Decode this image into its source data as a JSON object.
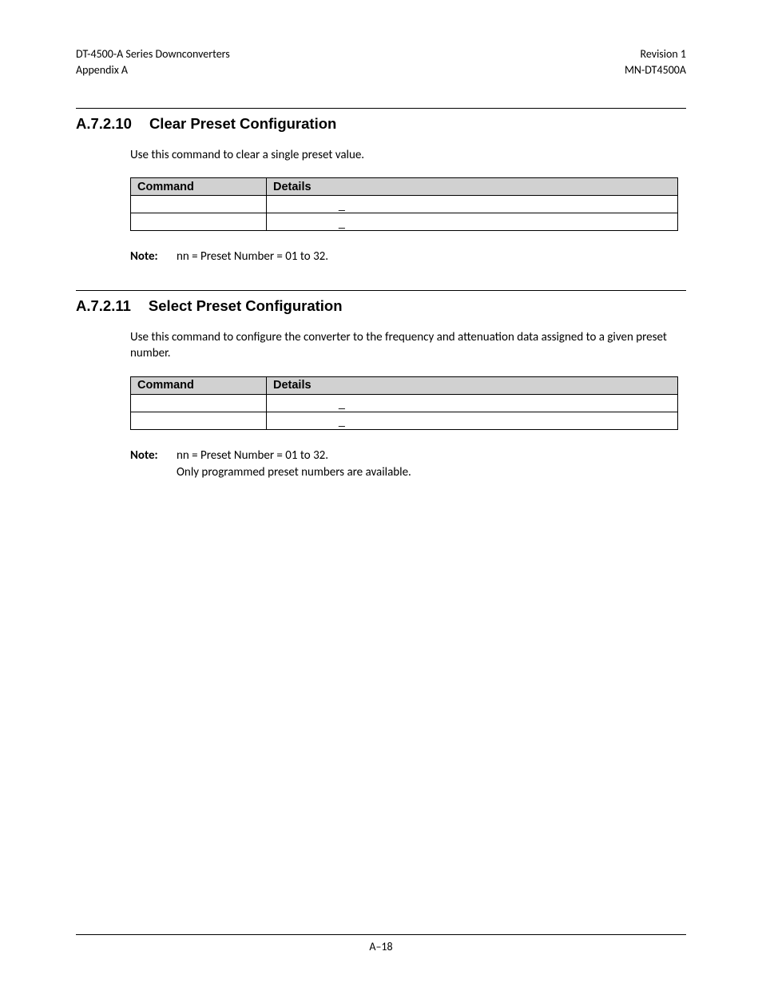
{
  "header": {
    "left_line1": "DT-4500-A Series Downconverters",
    "left_line2": "Appendix A",
    "right_line1": "Revision 1",
    "right_line2": "MN-DT4500A"
  },
  "sections": {
    "s1": {
      "number": "A.7.2.10",
      "title": "Clear Preset Configuration",
      "intro": "Use this command to clear a single preset value.",
      "table": {
        "header_command": "Command",
        "header_details": "Details",
        "row1_cmd": "",
        "row1_det": "_",
        "row2_cmd": "",
        "row2_det": "_"
      },
      "note_label": "Note:",
      "note_body_line1": "nn = Preset Number = 01 to 32."
    },
    "s2": {
      "number": "A.7.2.11",
      "title": "Select Preset Configuration",
      "intro": "Use this command to configure the converter to the frequency and attenuation data assigned to a given preset number.",
      "table": {
        "header_command": "Command",
        "header_details": "Details",
        "row1_cmd": "",
        "row1_det": "_",
        "row2_cmd": "",
        "row2_det": "_"
      },
      "note_label": "Note:",
      "note_body_line1": "nn = Preset Number = 01 to 32.",
      "note_body_line2": "Only programmed preset numbers are available."
    }
  },
  "footer": {
    "page": "A–18"
  }
}
